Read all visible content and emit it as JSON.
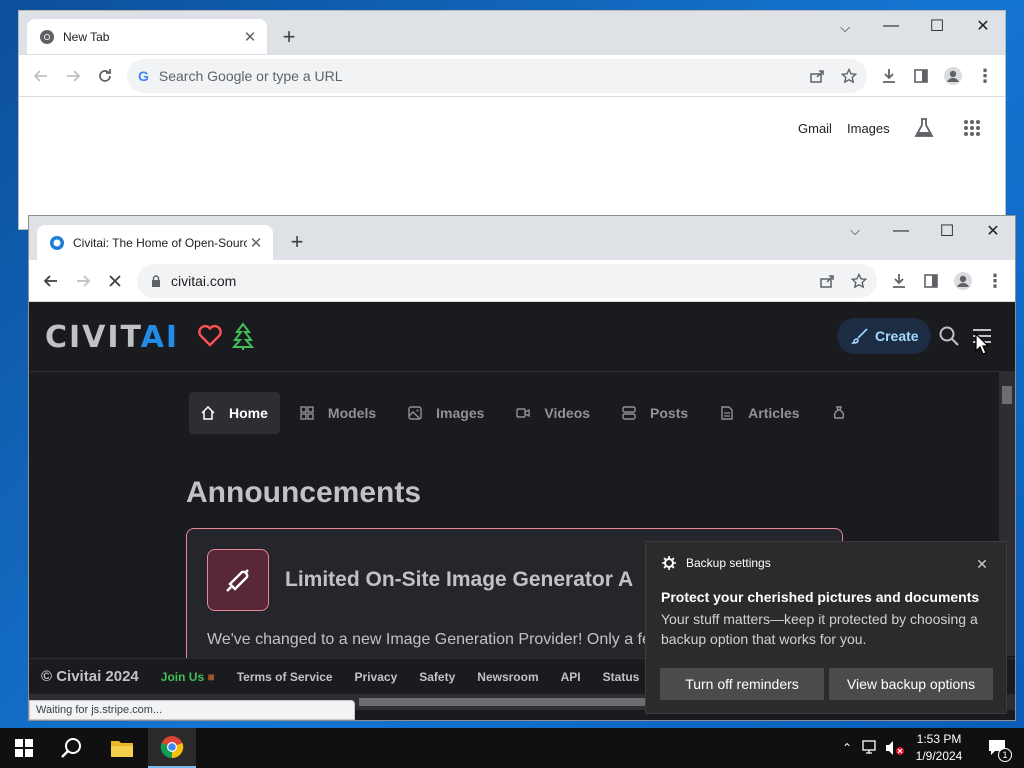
{
  "back_window": {
    "tab_title": "New Tab",
    "omnibox_placeholder": "Search Google or type a URL",
    "links": {
      "gmail": "Gmail",
      "images": "Images"
    }
  },
  "front_window": {
    "tab_title": "Civitai: The Home of Open-Source",
    "url": "civitai.com"
  },
  "site": {
    "logo_left": "CIVIT",
    "logo_right": "AI",
    "create_label": "Create",
    "nav": [
      "Home",
      "Models",
      "Images",
      "Videos",
      "Posts",
      "Articles"
    ],
    "announcements_heading": "Announcements",
    "announcement": {
      "title": "Limited On-Site Image Generator A",
      "body": "We've changed to a new Image Generation Provider! Only a fe"
    },
    "footer": {
      "copyright": "© Civitai 2024",
      "join": "Join Us",
      "links": [
        "Terms of Service",
        "Privacy",
        "Safety",
        "Newsroom",
        "API",
        "Status"
      ]
    },
    "status_text": "Waiting for js.stripe.com..."
  },
  "toast": {
    "app": "Backup settings",
    "title": "Protect your cherished pictures and documents",
    "body": "Your stuff matters—keep it protected by choosing a backup option that works for you.",
    "button_off": "Turn off reminders",
    "button_view": "View backup options"
  },
  "taskbar": {
    "time": "1:53 PM",
    "date": "1/9/2024",
    "notification_count": "1"
  },
  "colors": {
    "civitai_blue": "#228be6",
    "heart": "#fa5252",
    "tree": "#40c057",
    "announcement_border": "#e8869a"
  }
}
